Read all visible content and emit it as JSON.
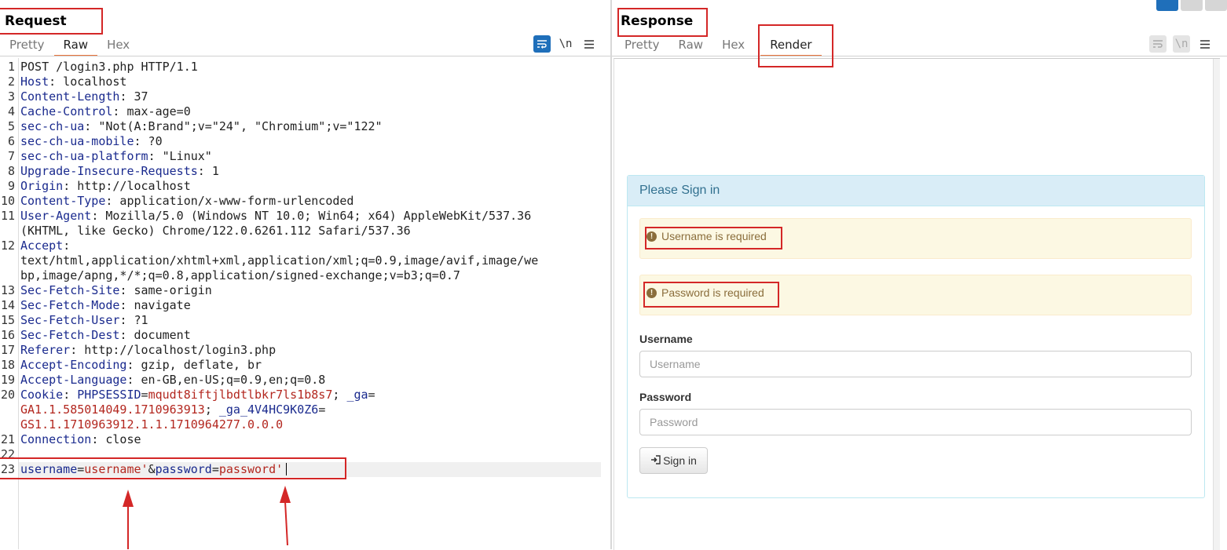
{
  "request": {
    "title": "Request",
    "tabs": [
      "Pretty",
      "Raw",
      "Hex"
    ],
    "toolbar": {
      "wrap_icon": "wrap-lines-icon",
      "newline_label": "\\n",
      "menu_icon": "hamburger-menu-icon"
    },
    "lines": [
      {
        "n": "1",
        "segs": [
          [
            "p",
            "POST /login3.php HTTP/1.1"
          ]
        ]
      },
      {
        "n": "2",
        "segs": [
          [
            "k",
            "Host"
          ],
          [
            "p",
            ": localhost"
          ]
        ]
      },
      {
        "n": "3",
        "segs": [
          [
            "k",
            "Content-Length"
          ],
          [
            "p",
            ": 37"
          ]
        ]
      },
      {
        "n": "4",
        "segs": [
          [
            "k",
            "Cache-Control"
          ],
          [
            "p",
            ": max-age=0"
          ]
        ]
      },
      {
        "n": "5",
        "segs": [
          [
            "k",
            "sec-ch-ua"
          ],
          [
            "p",
            ": \"Not(A:Brand\";v=\"24\", \"Chromium\";v=\"122\""
          ]
        ]
      },
      {
        "n": "6",
        "segs": [
          [
            "k",
            "sec-ch-ua-mobile"
          ],
          [
            "p",
            ": ?0"
          ]
        ]
      },
      {
        "n": "7",
        "segs": [
          [
            "k",
            "sec-ch-ua-platform"
          ],
          [
            "p",
            ": \"Linux\""
          ]
        ]
      },
      {
        "n": "8",
        "segs": [
          [
            "k",
            "Upgrade-Insecure-Requests"
          ],
          [
            "p",
            ": 1"
          ]
        ]
      },
      {
        "n": "9",
        "segs": [
          [
            "k",
            "Origin"
          ],
          [
            "p",
            ": http://localhost"
          ]
        ]
      },
      {
        "n": "10",
        "segs": [
          [
            "k",
            "Content-Type"
          ],
          [
            "p",
            ": application/x-www-form-urlencoded"
          ]
        ]
      },
      {
        "n": "11",
        "segs": [
          [
            "k",
            "User-Agent"
          ],
          [
            "p",
            ": Mozilla/5.0 (Windows NT 10.0; Win64; x64) AppleWebKit/537.36"
          ]
        ]
      },
      {
        "n": "",
        "segs": [
          [
            "p",
            "(KHTML, like Gecko) Chrome/122.0.6261.112 Safari/537.36"
          ]
        ]
      },
      {
        "n": "12",
        "segs": [
          [
            "k",
            "Accept"
          ],
          [
            "p",
            ":"
          ]
        ]
      },
      {
        "n": "",
        "segs": [
          [
            "p",
            "text/html,application/xhtml+xml,application/xml;q=0.9,image/avif,image/we"
          ]
        ]
      },
      {
        "n": "",
        "segs": [
          [
            "p",
            "bp,image/apng,*/*;q=0.8,application/signed-exchange;v=b3;q=0.7"
          ]
        ]
      },
      {
        "n": "13",
        "segs": [
          [
            "k",
            "Sec-Fetch-Site"
          ],
          [
            "p",
            ": same-origin"
          ]
        ]
      },
      {
        "n": "14",
        "segs": [
          [
            "k",
            "Sec-Fetch-Mode"
          ],
          [
            "p",
            ": navigate"
          ]
        ]
      },
      {
        "n": "15",
        "segs": [
          [
            "k",
            "Sec-Fetch-User"
          ],
          [
            "p",
            ": ?1"
          ]
        ]
      },
      {
        "n": "16",
        "segs": [
          [
            "k",
            "Sec-Fetch-Dest"
          ],
          [
            "p",
            ": document"
          ]
        ]
      },
      {
        "n": "17",
        "segs": [
          [
            "k",
            "Referer"
          ],
          [
            "p",
            ": http://localhost/login3.php"
          ]
        ]
      },
      {
        "n": "18",
        "segs": [
          [
            "k",
            "Accept-Encoding"
          ],
          [
            "p",
            ": gzip, deflate, br"
          ]
        ]
      },
      {
        "n": "19",
        "segs": [
          [
            "k",
            "Accept-Language"
          ],
          [
            "p",
            ": en-GB,en-US;q=0.9,en;q=0.8"
          ]
        ]
      },
      {
        "n": "20",
        "segs": [
          [
            "k",
            "Cookie"
          ],
          [
            "p",
            ": "
          ],
          [
            "k",
            "PHPSESSID"
          ],
          [
            "p",
            "="
          ],
          [
            "s",
            "mqudt8iftjlbdtlbkr7ls1b8s7"
          ],
          [
            "p",
            "; "
          ],
          [
            "k",
            "_ga"
          ],
          [
            "p",
            "="
          ]
        ]
      },
      {
        "n": "",
        "segs": [
          [
            "s",
            "GA1.1.585014049.1710963913"
          ],
          [
            "p",
            "; "
          ],
          [
            "k",
            "_ga_4V4HC9K0Z6"
          ],
          [
            "p",
            "="
          ]
        ]
      },
      {
        "n": "",
        "segs": [
          [
            "s",
            "GS1.1.1710963912.1.1.1710964277.0.0.0"
          ]
        ]
      },
      {
        "n": "21",
        "segs": [
          [
            "k",
            "Connection"
          ],
          [
            "p",
            ": close"
          ]
        ]
      },
      {
        "n": "22",
        "segs": []
      },
      {
        "n": "23",
        "segs": [
          [
            "k",
            "username"
          ],
          [
            "p",
            "="
          ],
          [
            "s",
            "username'"
          ],
          [
            "p",
            "&"
          ],
          [
            "k",
            "password"
          ],
          [
            "p",
            "="
          ],
          [
            "s",
            "password'"
          ]
        ]
      }
    ]
  },
  "response": {
    "title": "Response",
    "tabs": [
      "Pretty",
      "Raw",
      "Hex",
      "Render"
    ],
    "toolbar": {
      "wrap_icon": "wrap-lines-icon",
      "newline_label": "\\n",
      "menu_icon": "hamburger-menu-icon"
    },
    "render": {
      "panel_title": "Please Sign in",
      "alerts": [
        "Username is required",
        "Password is required"
      ],
      "username_label": "Username",
      "username_placeholder": "Username",
      "password_label": "Password",
      "password_placeholder": "Password",
      "signin_label": "Sign in"
    }
  },
  "colors": {
    "accent": "#e8743b",
    "highlight_box": "#d42727",
    "key": "#1a2a8e",
    "value": "#b3271f"
  }
}
